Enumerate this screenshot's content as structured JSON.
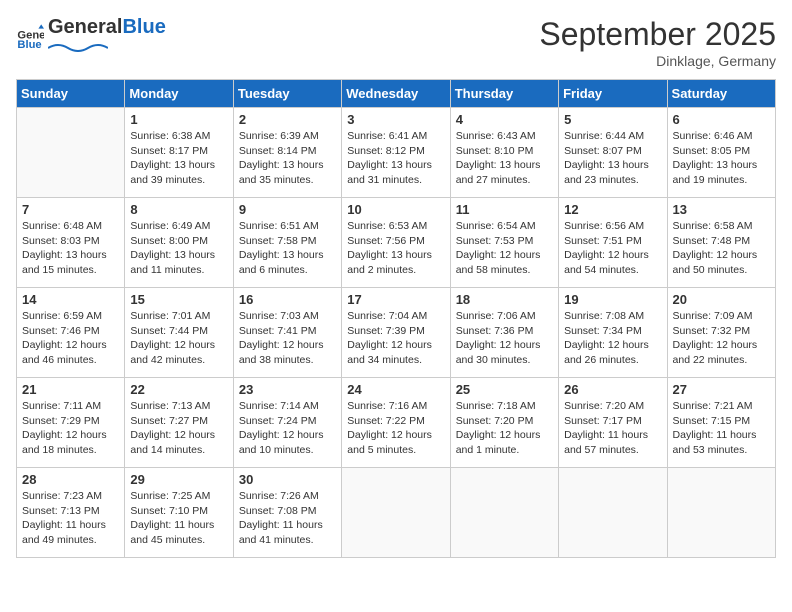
{
  "header": {
    "logo_general": "General",
    "logo_blue": "Blue",
    "month_title": "September 2025",
    "location": "Dinklage, Germany"
  },
  "days_of_week": [
    "Sunday",
    "Monday",
    "Tuesday",
    "Wednesday",
    "Thursday",
    "Friday",
    "Saturday"
  ],
  "weeks": [
    [
      {
        "day": "",
        "sunrise": "",
        "sunset": "",
        "daylight": ""
      },
      {
        "day": "1",
        "sunrise": "Sunrise: 6:38 AM",
        "sunset": "Sunset: 8:17 PM",
        "daylight": "Daylight: 13 hours and 39 minutes."
      },
      {
        "day": "2",
        "sunrise": "Sunrise: 6:39 AM",
        "sunset": "Sunset: 8:14 PM",
        "daylight": "Daylight: 13 hours and 35 minutes."
      },
      {
        "day": "3",
        "sunrise": "Sunrise: 6:41 AM",
        "sunset": "Sunset: 8:12 PM",
        "daylight": "Daylight: 13 hours and 31 minutes."
      },
      {
        "day": "4",
        "sunrise": "Sunrise: 6:43 AM",
        "sunset": "Sunset: 8:10 PM",
        "daylight": "Daylight: 13 hours and 27 minutes."
      },
      {
        "day": "5",
        "sunrise": "Sunrise: 6:44 AM",
        "sunset": "Sunset: 8:07 PM",
        "daylight": "Daylight: 13 hours and 23 minutes."
      },
      {
        "day": "6",
        "sunrise": "Sunrise: 6:46 AM",
        "sunset": "Sunset: 8:05 PM",
        "daylight": "Daylight: 13 hours and 19 minutes."
      }
    ],
    [
      {
        "day": "7",
        "sunrise": "Sunrise: 6:48 AM",
        "sunset": "Sunset: 8:03 PM",
        "daylight": "Daylight: 13 hours and 15 minutes."
      },
      {
        "day": "8",
        "sunrise": "Sunrise: 6:49 AM",
        "sunset": "Sunset: 8:00 PM",
        "daylight": "Daylight: 13 hours and 11 minutes."
      },
      {
        "day": "9",
        "sunrise": "Sunrise: 6:51 AM",
        "sunset": "Sunset: 7:58 PM",
        "daylight": "Daylight: 13 hours and 6 minutes."
      },
      {
        "day": "10",
        "sunrise": "Sunrise: 6:53 AM",
        "sunset": "Sunset: 7:56 PM",
        "daylight": "Daylight: 13 hours and 2 minutes."
      },
      {
        "day": "11",
        "sunrise": "Sunrise: 6:54 AM",
        "sunset": "Sunset: 7:53 PM",
        "daylight": "Daylight: 12 hours and 58 minutes."
      },
      {
        "day": "12",
        "sunrise": "Sunrise: 6:56 AM",
        "sunset": "Sunset: 7:51 PM",
        "daylight": "Daylight: 12 hours and 54 minutes."
      },
      {
        "day": "13",
        "sunrise": "Sunrise: 6:58 AM",
        "sunset": "Sunset: 7:48 PM",
        "daylight": "Daylight: 12 hours and 50 minutes."
      }
    ],
    [
      {
        "day": "14",
        "sunrise": "Sunrise: 6:59 AM",
        "sunset": "Sunset: 7:46 PM",
        "daylight": "Daylight: 12 hours and 46 minutes."
      },
      {
        "day": "15",
        "sunrise": "Sunrise: 7:01 AM",
        "sunset": "Sunset: 7:44 PM",
        "daylight": "Daylight: 12 hours and 42 minutes."
      },
      {
        "day": "16",
        "sunrise": "Sunrise: 7:03 AM",
        "sunset": "Sunset: 7:41 PM",
        "daylight": "Daylight: 12 hours and 38 minutes."
      },
      {
        "day": "17",
        "sunrise": "Sunrise: 7:04 AM",
        "sunset": "Sunset: 7:39 PM",
        "daylight": "Daylight: 12 hours and 34 minutes."
      },
      {
        "day": "18",
        "sunrise": "Sunrise: 7:06 AM",
        "sunset": "Sunset: 7:36 PM",
        "daylight": "Daylight: 12 hours and 30 minutes."
      },
      {
        "day": "19",
        "sunrise": "Sunrise: 7:08 AM",
        "sunset": "Sunset: 7:34 PM",
        "daylight": "Daylight: 12 hours and 26 minutes."
      },
      {
        "day": "20",
        "sunrise": "Sunrise: 7:09 AM",
        "sunset": "Sunset: 7:32 PM",
        "daylight": "Daylight: 12 hours and 22 minutes."
      }
    ],
    [
      {
        "day": "21",
        "sunrise": "Sunrise: 7:11 AM",
        "sunset": "Sunset: 7:29 PM",
        "daylight": "Daylight: 12 hours and 18 minutes."
      },
      {
        "day": "22",
        "sunrise": "Sunrise: 7:13 AM",
        "sunset": "Sunset: 7:27 PM",
        "daylight": "Daylight: 12 hours and 14 minutes."
      },
      {
        "day": "23",
        "sunrise": "Sunrise: 7:14 AM",
        "sunset": "Sunset: 7:24 PM",
        "daylight": "Daylight: 12 hours and 10 minutes."
      },
      {
        "day": "24",
        "sunrise": "Sunrise: 7:16 AM",
        "sunset": "Sunset: 7:22 PM",
        "daylight": "Daylight: 12 hours and 5 minutes."
      },
      {
        "day": "25",
        "sunrise": "Sunrise: 7:18 AM",
        "sunset": "Sunset: 7:20 PM",
        "daylight": "Daylight: 12 hours and 1 minute."
      },
      {
        "day": "26",
        "sunrise": "Sunrise: 7:20 AM",
        "sunset": "Sunset: 7:17 PM",
        "daylight": "Daylight: 11 hours and 57 minutes."
      },
      {
        "day": "27",
        "sunrise": "Sunrise: 7:21 AM",
        "sunset": "Sunset: 7:15 PM",
        "daylight": "Daylight: 11 hours and 53 minutes."
      }
    ],
    [
      {
        "day": "28",
        "sunrise": "Sunrise: 7:23 AM",
        "sunset": "Sunset: 7:13 PM",
        "daylight": "Daylight: 11 hours and 49 minutes."
      },
      {
        "day": "29",
        "sunrise": "Sunrise: 7:25 AM",
        "sunset": "Sunset: 7:10 PM",
        "daylight": "Daylight: 11 hours and 45 minutes."
      },
      {
        "day": "30",
        "sunrise": "Sunrise: 7:26 AM",
        "sunset": "Sunset: 7:08 PM",
        "daylight": "Daylight: 11 hours and 41 minutes."
      },
      {
        "day": "",
        "sunrise": "",
        "sunset": "",
        "daylight": ""
      },
      {
        "day": "",
        "sunrise": "",
        "sunset": "",
        "daylight": ""
      },
      {
        "day": "",
        "sunrise": "",
        "sunset": "",
        "daylight": ""
      },
      {
        "day": "",
        "sunrise": "",
        "sunset": "",
        "daylight": ""
      }
    ]
  ]
}
